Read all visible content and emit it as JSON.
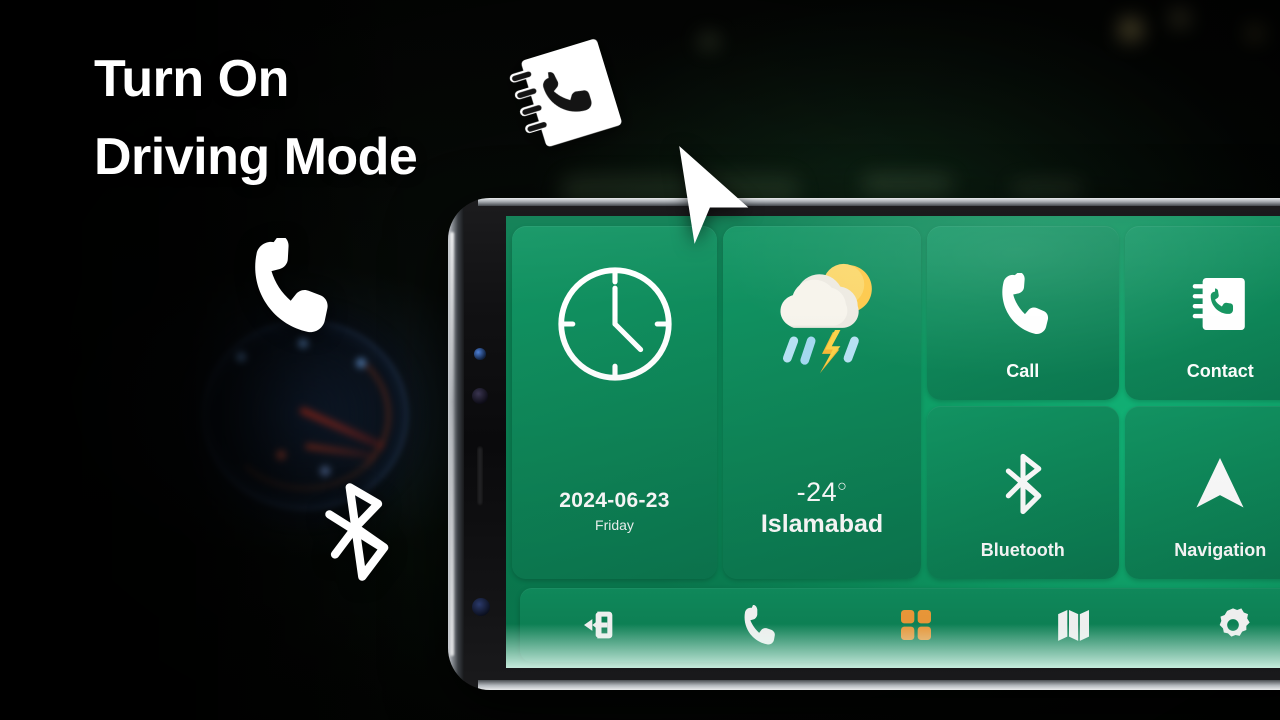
{
  "headline": {
    "line1": "Turn On",
    "line2": "Driving Mode"
  },
  "floating_icons": [
    {
      "name": "contact-book-icon",
      "label": "Contact Book"
    },
    {
      "name": "phone-handset-icon",
      "label": "Phone"
    },
    {
      "name": "bluetooth-icon",
      "label": "Bluetooth"
    },
    {
      "name": "navigation-cursor-icon",
      "label": "Navigation Cursor"
    }
  ],
  "phone": {
    "screen": {
      "clock_widget": {
        "icon": "analog-clock-icon",
        "date": "2024-06-23",
        "day": "Friday",
        "time_hour": 4,
        "time_minute": 0
      },
      "weather_widget": {
        "icon": "storm-cloud-sun-icon",
        "temperature": "-24",
        "degree_symbol": "○",
        "city": "Islamabad"
      },
      "app_tiles": [
        {
          "icon": "phone-call-icon",
          "label": "Call"
        },
        {
          "icon": "contact-book-icon",
          "label": "Contact"
        },
        {
          "icon": "bluetooth-icon",
          "label": "Bluetooth"
        },
        {
          "icon": "navigation-arrow-icon",
          "label": "Navigation"
        }
      ],
      "navbar": [
        {
          "icon": "exit-icon",
          "label": "Exit",
          "active": false
        },
        {
          "icon": "phone-icon",
          "label": "Phone",
          "active": false
        },
        {
          "icon": "apps-grid-icon",
          "label": "Apps",
          "active": true
        },
        {
          "icon": "map-icon",
          "label": "Map",
          "active": false
        },
        {
          "icon": "gear-icon",
          "label": "Settings",
          "active": false
        }
      ]
    }
  },
  "colors": {
    "tile_green": "#0E8A5B",
    "screen_green": "#10A86D",
    "accent_orange": "#F7A03C",
    "text_white": "#FFFFFF",
    "background_black": "#050706"
  }
}
